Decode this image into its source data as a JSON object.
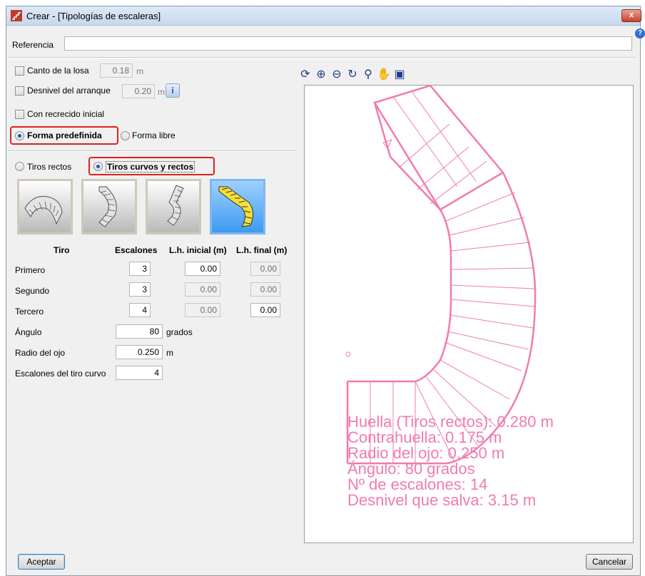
{
  "window": {
    "title": "Crear - [Tipologías de escaleras]",
    "close_label": "x"
  },
  "help_label": "?",
  "referencia": {
    "label": "Referencia",
    "value": ""
  },
  "canto": {
    "label": "Canto de la losa",
    "value": "0.18",
    "unit": "m",
    "checked": false
  },
  "desnivel": {
    "label": "Desnivel del arranque",
    "value": "0.20",
    "unit": "m",
    "checked": false,
    "info_label": "i"
  },
  "recrecido": {
    "label": "Con recrecido inicial",
    "checked": false
  },
  "forma": {
    "predefinida_label": "Forma predefinida",
    "libre_label": "Forma libre",
    "selected": "predefinida"
  },
  "tiros": {
    "rectos_label": "Tiros rectos",
    "curvos_label": "Tiros curvos y rectos",
    "selected": "curvos"
  },
  "table": {
    "headers": {
      "tiro": "Tiro",
      "escalones": "Escalones",
      "lh_inicial": "L.h. inicial (m)",
      "lh_final": "L.h. final (m)"
    },
    "rows": [
      {
        "name": "Primero",
        "escalones": "3",
        "lh_inicial": "0.00",
        "lh_final": "0.00"
      },
      {
        "name": "Segundo",
        "escalones": "3",
        "lh_inicial": "0.00",
        "lh_final": "0.00"
      },
      {
        "name": "Tercero",
        "escalones": "4",
        "lh_inicial": "0.00",
        "lh_final": "0.00"
      }
    ]
  },
  "angulo": {
    "label": "Ángulo",
    "value": "80",
    "unit": "grados"
  },
  "radio": {
    "label": "Radio del ojo",
    "value": "0.250",
    "unit": "m"
  },
  "escalones_curvo": {
    "label": "Escalones del tiro curvo",
    "value": "4"
  },
  "preview": {
    "stroke_color": "#f07cb0",
    "lines": [
      "Huella (Tiros rectos): 0.280 m",
      "Contrahuella: 0.175 m",
      "Radio del ojo: 0.250 m",
      "Ángulo: 80 grados",
      "Nº de escalones: 14",
      "Desnivel que salva: 3.15 m"
    ]
  },
  "toolbar_icons": [
    "zoom-extents-icon",
    "zoom-window-icon",
    "zoom-out-icon",
    "redraw-icon",
    "zoom-in-icon",
    "pan-hand-icon",
    "copy-view-icon"
  ],
  "buttons": {
    "aceptar": "Aceptar",
    "cancelar": "Cancelar"
  }
}
